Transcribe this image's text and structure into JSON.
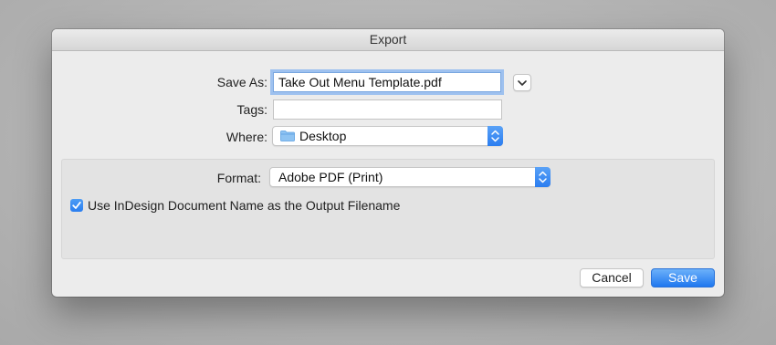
{
  "window": {
    "title": "Export"
  },
  "form": {
    "save_as_label": "Save As:",
    "save_as_value": "Take Out Menu Template.pdf",
    "tags_label": "Tags:",
    "tags_value": "",
    "where_label": "Where:",
    "where_value": "Desktop",
    "where_icon": "folder-icon"
  },
  "options": {
    "format_label": "Format:",
    "format_value": "Adobe PDF (Print)",
    "use_doc_name_label": "Use InDesign Document Name as the Output Filename",
    "use_doc_name_checked": true
  },
  "buttons": {
    "cancel_label": "Cancel",
    "save_label": "Save"
  },
  "colors": {
    "accent": "#2a7ef0",
    "focus_ring": "#9ec1ef"
  }
}
